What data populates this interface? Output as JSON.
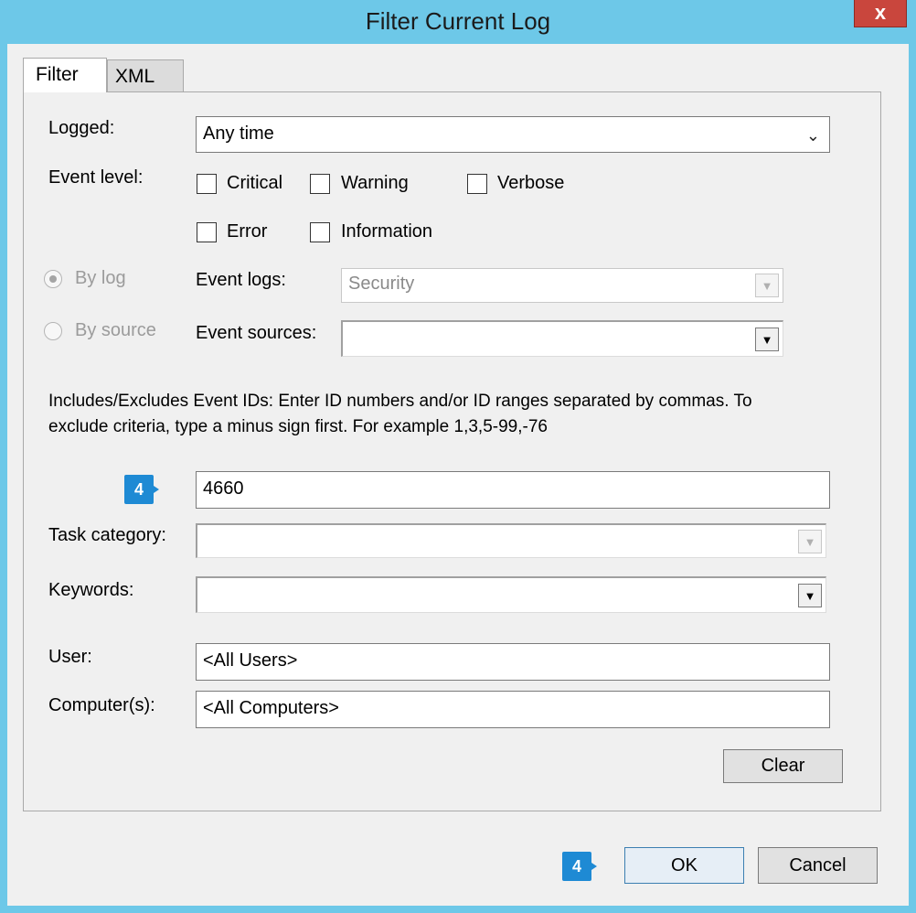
{
  "window": {
    "title": "Filter Current Log",
    "close_glyph": "x"
  },
  "tabs": [
    {
      "label": "Filter"
    },
    {
      "label": "XML"
    }
  ],
  "filter": {
    "logged_label": "Logged:",
    "logged_value": "Any time",
    "event_level_label": "Event level:",
    "levels": {
      "critical": "Critical",
      "warning": "Warning",
      "verbose": "Verbose",
      "error": "Error",
      "information": "Information"
    },
    "by_log_label": "By log",
    "by_source_label": "By source",
    "event_logs_label": "Event logs:",
    "event_logs_value": "Security",
    "event_sources_label": "Event sources:",
    "event_sources_value": "",
    "ids_help_line1": "Includes/Excludes Event IDs: Enter ID numbers and/or ID ranges separated by commas. To",
    "ids_help_line2": "exclude criteria, type a minus sign first. For example 1,3,5-99,-76",
    "event_ids_value": "4660",
    "task_category_label": "Task category:",
    "task_category_value": "",
    "keywords_label": "Keywords:",
    "keywords_value": "",
    "user_label": "User:",
    "user_value": "<All Users>",
    "computers_label": "Computer(s):",
    "computers_value": "<All Computers>",
    "clear_label": "Clear"
  },
  "footer": {
    "ok_label": "OK",
    "cancel_label": "Cancel"
  },
  "markers": {
    "ids_step": "4",
    "ok_step": "4"
  },
  "colors": {
    "title_bar": "#6dc8e8",
    "close_button": "#c9463d",
    "marker": "#1e8ad4"
  }
}
